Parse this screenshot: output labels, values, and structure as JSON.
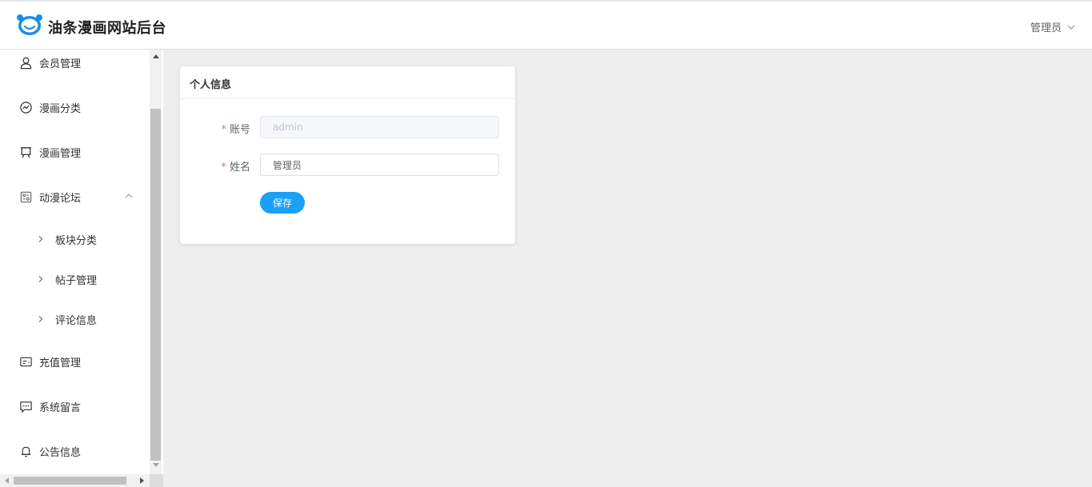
{
  "header": {
    "title": "油条漫画网站后台",
    "user_label": "管理员"
  },
  "sidebar": {
    "items": [
      {
        "label": "会员管理",
        "icon": "user-icon"
      },
      {
        "label": "漫画分类",
        "icon": "dashboard-icon"
      },
      {
        "label": "漫画管理",
        "icon": "easel-icon"
      },
      {
        "label": "动漫论坛",
        "icon": "forum-icon",
        "expanded": true,
        "children": [
          {
            "label": "板块分类"
          },
          {
            "label": "帖子管理"
          },
          {
            "label": "评论信息"
          }
        ]
      },
      {
        "label": "充值管理",
        "icon": "card-icon"
      },
      {
        "label": "系统留言",
        "icon": "chat-icon"
      },
      {
        "label": "公告信息",
        "icon": "bell-icon"
      }
    ]
  },
  "profile": {
    "title": "个人信息",
    "account_label": "账号",
    "account_value": "admin",
    "name_label": "姓名",
    "name_value": "管理员",
    "required_mark": "*",
    "save_label": "保存"
  },
  "colors": {
    "accent": "#1aa0f8",
    "required": "#f56c6c",
    "background": "#eeeeee"
  }
}
